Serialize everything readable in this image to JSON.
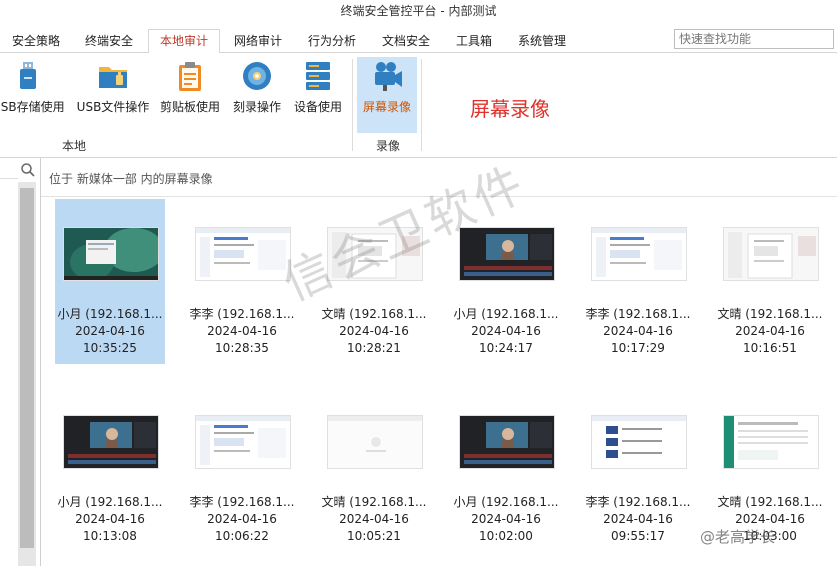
{
  "window": {
    "title": "终端安全管控平台 - 内部测试"
  },
  "tabs": [
    {
      "label": "安全策略",
      "active": false
    },
    {
      "label": "终端安全",
      "active": false
    },
    {
      "label": "本地审计",
      "active": true
    },
    {
      "label": "网络审计",
      "active": false
    },
    {
      "label": "行为分析",
      "active": false
    },
    {
      "label": "文档安全",
      "active": false
    },
    {
      "label": "工具箱",
      "active": false
    },
    {
      "label": "系统管理",
      "active": false
    }
  ],
  "search": {
    "placeholder": "快速查找功能"
  },
  "ribbon": {
    "groups": [
      {
        "label": "本地",
        "items": [
          {
            "label": "USB存储使用",
            "icon": "usb-drive-icon"
          },
          {
            "label": "USB文件操作",
            "icon": "usb-folder-icon"
          },
          {
            "label": "剪贴板使用",
            "icon": "clipboard-icon"
          },
          {
            "label": "刻录操作",
            "icon": "disc-icon"
          },
          {
            "label": "设备使用",
            "icon": "device-stack-icon"
          }
        ]
      },
      {
        "label": "录像",
        "items": [
          {
            "label": "屏幕录像",
            "icon": "video-camera-icon",
            "selected": true
          }
        ]
      }
    ],
    "section_title": "屏幕录像"
  },
  "breadcrumb": "位于 新媒体一部 内的屏幕录像",
  "recordings": [
    {
      "name": "小月 (192.168.1...",
      "date": "2024-04-16",
      "time": "10:35:25",
      "thumb": "desktop",
      "selected": true
    },
    {
      "name": "李李 (192.168.1...",
      "date": "2024-04-16",
      "time": "10:28:35",
      "thumb": "web"
    },
    {
      "name": "文晴 (192.168.1...",
      "date": "2024-04-16",
      "time": "10:28:21",
      "thumb": "doc"
    },
    {
      "name": "小月 (192.168.1...",
      "date": "2024-04-16",
      "time": "10:24:17",
      "thumb": "editor"
    },
    {
      "name": "李李 (192.168.1...",
      "date": "2024-04-16",
      "time": "10:17:29",
      "thumb": "web"
    },
    {
      "name": "文晴 (192.168.1...",
      "date": "2024-04-16",
      "time": "10:16:51",
      "thumb": "doc"
    },
    {
      "name": "小月 (192.168.1...",
      "date": "2024-04-16",
      "time": "10:13:08",
      "thumb": "editor"
    },
    {
      "name": "李李 (192.168.1...",
      "date": "2024-04-16",
      "time": "10:06:22",
      "thumb": "web"
    },
    {
      "name": "文晴 (192.168.1...",
      "date": "2024-04-16",
      "time": "10:05:21",
      "thumb": "blank"
    },
    {
      "name": "小月 (192.168.1...",
      "date": "2024-04-16",
      "time": "10:02:00",
      "thumb": "editor"
    },
    {
      "name": "李李 (192.168.1...",
      "date": "2024-04-16",
      "time": "09:55:17",
      "thumb": "list"
    },
    {
      "name": "文晴 (192.168.1...",
      "date": "2024-04-16",
      "time": "10:03:00",
      "thumb": "sheet"
    }
  ],
  "watermark": "信会卫软件",
  "credit": "@老高学长"
}
